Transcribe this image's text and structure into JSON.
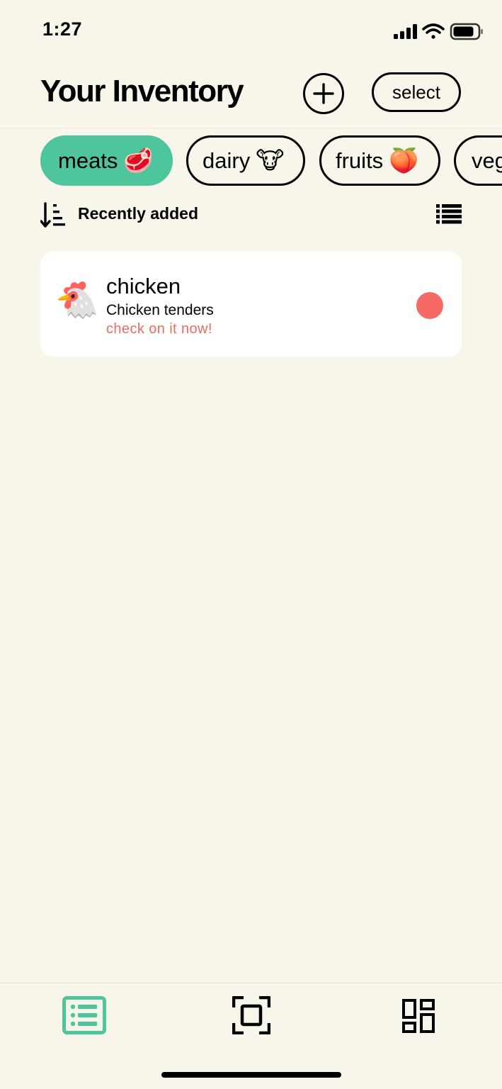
{
  "status_bar": {
    "time": "1:27",
    "icons": [
      "signal-icon",
      "wifi-icon",
      "battery-icon"
    ]
  },
  "header": {
    "title": "Your Inventory",
    "add_icon": "plus-circle-icon",
    "select_label": "select"
  },
  "categories": [
    {
      "label": "meats",
      "emoji": "🥩",
      "active": true
    },
    {
      "label": "dairy",
      "emoji": "🐮",
      "active": false
    },
    {
      "label": "fruits",
      "emoji": "🍑",
      "active": false
    },
    {
      "label": "veg",
      "emoji": "",
      "active": false
    }
  ],
  "sort": {
    "label": "Recently added",
    "icon": "sort-descending-icon",
    "view_icon": "list-view-icon"
  },
  "items": [
    {
      "emoji": "🐔",
      "name": "chicken",
      "description": "Chicken tenders",
      "status_text": "check on it now!",
      "status_color": "#f56a64"
    }
  ],
  "tabbar": {
    "tabs": [
      {
        "icon": "inventory-list-icon",
        "active": true
      },
      {
        "icon": "scan-icon",
        "active": false
      },
      {
        "icon": "dashboard-grid-icon",
        "active": false
      }
    ]
  },
  "colors": {
    "background": "#f8f5ea",
    "accent": "#4ec59c",
    "alert": "#f56a64",
    "card": "#ffffff"
  }
}
